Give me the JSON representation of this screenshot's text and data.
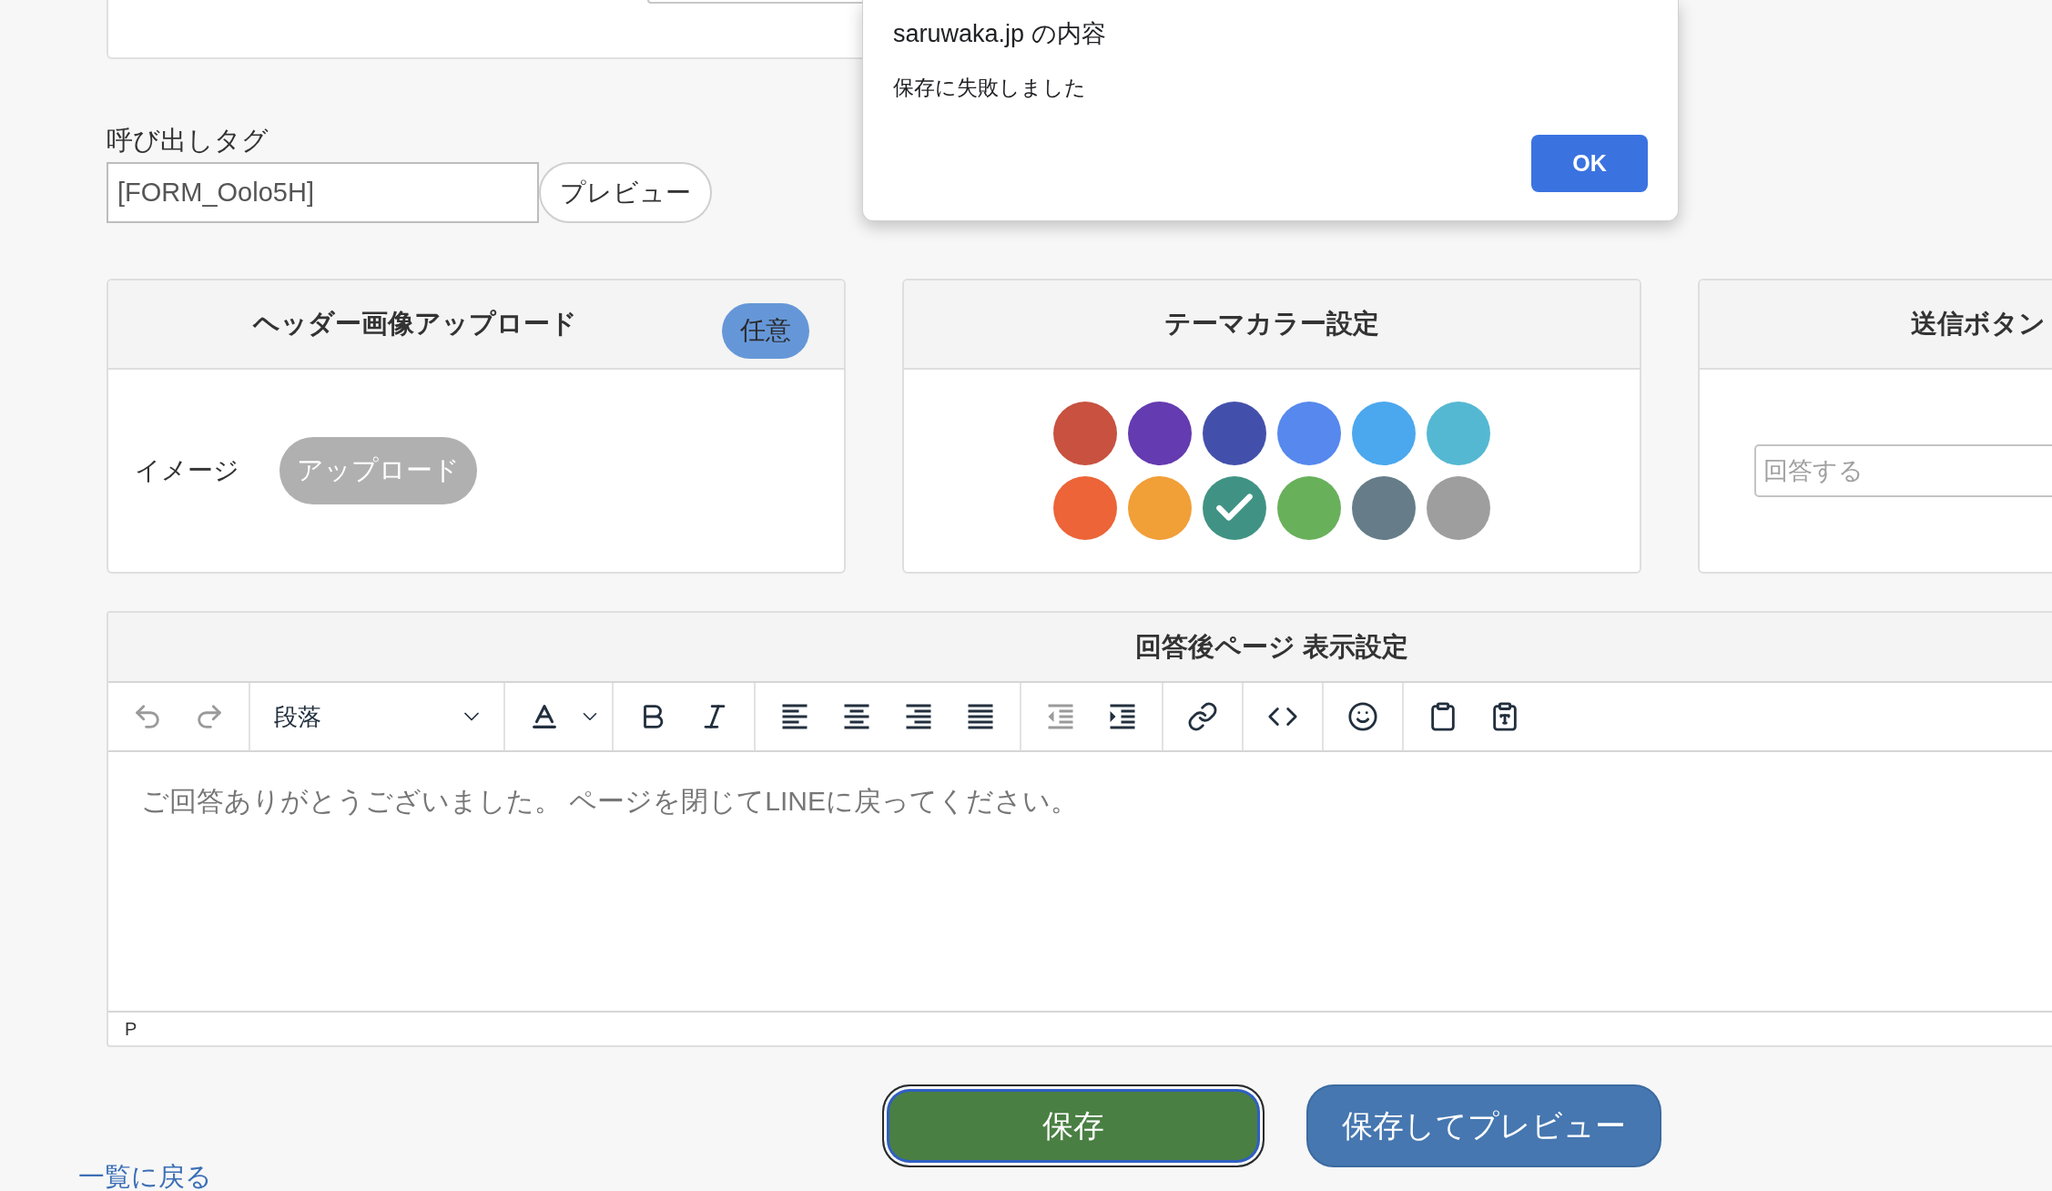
{
  "call_tag": {
    "label": "呼び出しタグ",
    "value": "[FORM_Oolo5H]",
    "preview_button": "プレビュー"
  },
  "cards": [
    {
      "kind": "upload",
      "title": "ヘッダー画像アップロード",
      "badge": "任意",
      "field_label": "イメージ",
      "upload_button": {
        "label": "アップロード",
        "disabled": true
      }
    },
    {
      "kind": "palette",
      "title": "テーマカラー設定",
      "swatches": [
        {
          "color": "#c85140",
          "selected": false
        },
        {
          "color": "#643bb0",
          "selected": false
        },
        {
          "color": "#4350ab",
          "selected": false
        },
        {
          "color": "#5688ee",
          "selected": false
        },
        {
          "color": "#4ba8ee",
          "selected": false
        },
        {
          "color": "#55b8d2",
          "selected": false
        },
        {
          "color": "#ec6438",
          "selected": false
        },
        {
          "color": "#f19f37",
          "selected": false
        },
        {
          "color": "#409384",
          "selected": true
        },
        {
          "color": "#69b05b",
          "selected": false
        },
        {
          "color": "#667d89",
          "selected": false
        },
        {
          "color": "#9e9e9e",
          "selected": false
        }
      ]
    },
    {
      "kind": "submit",
      "title": "送信ボタン",
      "field": {
        "placeholder": "回答する"
      }
    }
  ],
  "editor": {
    "title": "回答後ページ 表示設定",
    "toolbar": [
      [
        {
          "kind": "undo",
          "disabled": true
        },
        {
          "kind": "redo",
          "disabled": true
        }
      ],
      [
        {
          "kind": "blocks",
          "value": "段落",
          "disabled": false
        }
      ],
      [
        {
          "kind": "forecolor",
          "disabled": false
        }
      ],
      [
        {
          "kind": "bold",
          "disabled": false
        },
        {
          "kind": "italic",
          "disabled": false
        }
      ],
      [
        {
          "kind": "alignleft",
          "disabled": false
        },
        {
          "kind": "aligncenter",
          "disabled": false
        },
        {
          "kind": "alignright",
          "disabled": false
        },
        {
          "kind": "alignjustify",
          "disabled": false
        }
      ],
      [
        {
          "kind": "outdent",
          "disabled": true
        },
        {
          "kind": "indent",
          "disabled": false
        }
      ],
      [
        {
          "kind": "link",
          "disabled": false
        }
      ],
      [
        {
          "kind": "code",
          "disabled": false
        }
      ],
      [
        {
          "kind": "emoticons",
          "disabled": false
        }
      ],
      [
        {
          "kind": "paste",
          "disabled": false
        },
        {
          "kind": "pastetext",
          "disabled": false
        }
      ]
    ],
    "content": "ご回答ありがとうございました。 ページを閉じてLINEに戻ってください。",
    "status_path": "P"
  },
  "actions": [
    {
      "label": "保存",
      "kind": "primary",
      "focused": true
    },
    {
      "label": "保存してプレビュー",
      "kind": "secondary",
      "focused": false
    }
  ],
  "back_link": "一覧に戻る",
  "dialog": {
    "title": "saruwaka.jp の内容",
    "message": "保存に失敗しました",
    "button": "OK"
  }
}
